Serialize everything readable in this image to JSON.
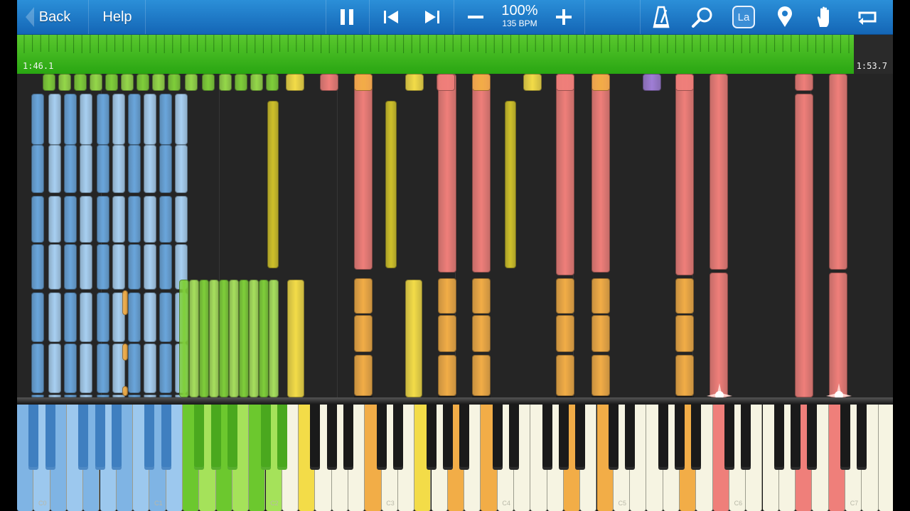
{
  "toolbar": {
    "back_label": "Back",
    "help_label": "Help",
    "tempo_percent": "100%",
    "tempo_bpm": "135 BPM",
    "label_button_text": "La",
    "icons": [
      "pause-icon",
      "skip-back-icon",
      "skip-forward-icon",
      "minus-icon",
      "plus-icon",
      "metronome-icon",
      "magnifier-icon",
      "note-labels-icon",
      "marker-icon",
      "hand-icon",
      "loop-icon"
    ]
  },
  "progress": {
    "current_time": "1:46.1",
    "total_time": "1:53.7",
    "fraction": 0.955
  },
  "keyboard": {
    "octave_labels": [
      "C0",
      "C1",
      "C2",
      "C3",
      "C4",
      "C5",
      "C6",
      "C7"
    ]
  },
  "colors": {
    "toolbar": "#1f7ccc",
    "progress": "#3bb51c",
    "blue_track": "#6aa6dc",
    "green_track": "#7fcf3a",
    "yellow_track": "#f3dc48",
    "orange_track": "#f2ad47",
    "red_track": "#ef7f7a",
    "purple_track": "#a07ed6"
  }
}
